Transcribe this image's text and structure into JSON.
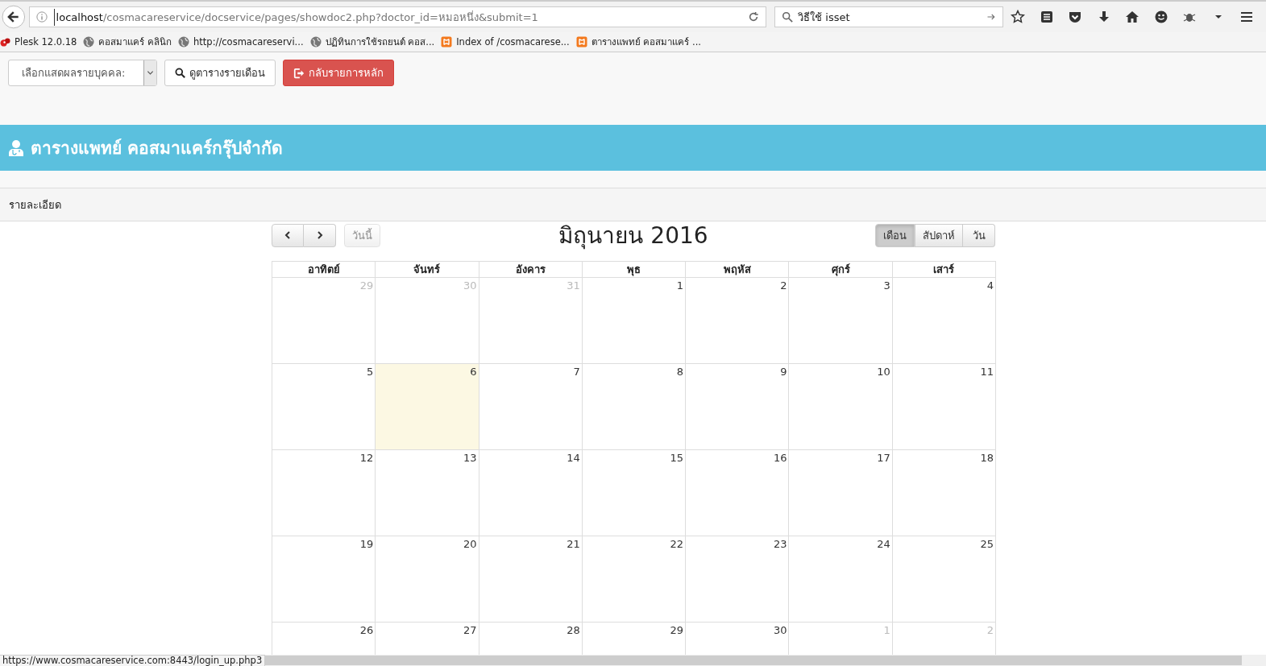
{
  "browser": {
    "url_host": "localhost",
    "url_path": "/cosmacareservice/docservice/pages/showdoc2.php?doctor_id=หมอหนึ่ง&submit=1",
    "search": "วิธีใช้ isset",
    "bookmarks": [
      {
        "label": "Plesk 12.0.18",
        "kind": "plesk"
      },
      {
        "label": "คอสมาแคร์ คลินิก",
        "kind": "globe"
      },
      {
        "label": "http://cosmacareservi...",
        "kind": "globe"
      },
      {
        "label": "ปฏิทินการใช้รถยนต์ คอส...",
        "kind": "globe"
      },
      {
        "label": "Index of /cosmacarese...",
        "kind": "xampp"
      },
      {
        "label": "ตารางแพทย์ คอสมาแคร์ ...",
        "kind": "xampp"
      }
    ]
  },
  "toolbar": {
    "select": "เลือกแสดผลรายบุคคล:",
    "buttons": [
      {
        "label": "ดูตารางรายเดือน",
        "kind": "search"
      },
      {
        "label": "กลับรายการหลัก",
        "kind": "exit"
      }
    ]
  },
  "header": {
    "title": "ตารางแพทย์ คอสมาแคร์กรุ๊ปจำกัด"
  },
  "panel": {
    "heading": "รายละเอียด"
  },
  "calendar": {
    "title": "มิถุนายน 2016",
    "today_button": {
      "label": "วันนี้",
      "disabled": true
    },
    "views": [
      {
        "label": "เดือน",
        "selected": true
      },
      {
        "label": "สัปดาห์",
        "selected": false
      },
      {
        "label": "วัน",
        "selected": false
      }
    ],
    "weekdays": [
      "อาทิตย์",
      "จันทร์",
      "อังคาร",
      "พุธ",
      "พฤหัส",
      "ศุกร์",
      "เสาร์"
    ],
    "weeks": [
      [
        {
          "day": "29",
          "other_month": true,
          "today": false
        },
        {
          "day": "30",
          "other_month": true,
          "today": false
        },
        {
          "day": "31",
          "other_month": true,
          "today": false
        },
        {
          "day": "1",
          "other_month": false,
          "today": false
        },
        {
          "day": "2",
          "other_month": false,
          "today": false
        },
        {
          "day": "3",
          "other_month": false,
          "today": false
        },
        {
          "day": "4",
          "other_month": false,
          "today": false
        }
      ],
      [
        {
          "day": "5",
          "other_month": false,
          "today": false
        },
        {
          "day": "6",
          "other_month": false,
          "today": true
        },
        {
          "day": "7",
          "other_month": false,
          "today": false
        },
        {
          "day": "8",
          "other_month": false,
          "today": false
        },
        {
          "day": "9",
          "other_month": false,
          "today": false
        },
        {
          "day": "10",
          "other_month": false,
          "today": false
        },
        {
          "day": "11",
          "other_month": false,
          "today": false
        }
      ],
      [
        {
          "day": "12",
          "other_month": false,
          "today": false
        },
        {
          "day": "13",
          "other_month": false,
          "today": false
        },
        {
          "day": "14",
          "other_month": false,
          "today": false
        },
        {
          "day": "15",
          "other_month": false,
          "today": false
        },
        {
          "day": "16",
          "other_month": false,
          "today": false
        },
        {
          "day": "17",
          "other_month": false,
          "today": false
        },
        {
          "day": "18",
          "other_month": false,
          "today": false
        }
      ],
      [
        {
          "day": "19",
          "other_month": false,
          "today": false
        },
        {
          "day": "20",
          "other_month": false,
          "today": false
        },
        {
          "day": "21",
          "other_month": false,
          "today": false
        },
        {
          "day": "22",
          "other_month": false,
          "today": false
        },
        {
          "day": "23",
          "other_month": false,
          "today": false
        },
        {
          "day": "24",
          "other_month": false,
          "today": false
        },
        {
          "day": "25",
          "other_month": false,
          "today": false
        }
      ],
      [
        {
          "day": "26",
          "other_month": false,
          "today": false
        },
        {
          "day": "27",
          "other_month": false,
          "today": false
        },
        {
          "day": "28",
          "other_month": false,
          "today": false
        },
        {
          "day": "29",
          "other_month": false,
          "today": false
        },
        {
          "day": "30",
          "other_month": false,
          "today": false
        },
        {
          "day": "1",
          "other_month": true,
          "today": false
        },
        {
          "day": "2",
          "other_month": true,
          "today": false
        }
      ]
    ]
  },
  "status_bar": {
    "url": "https://www.cosmacareservice.com:8443/login_up.php3"
  }
}
